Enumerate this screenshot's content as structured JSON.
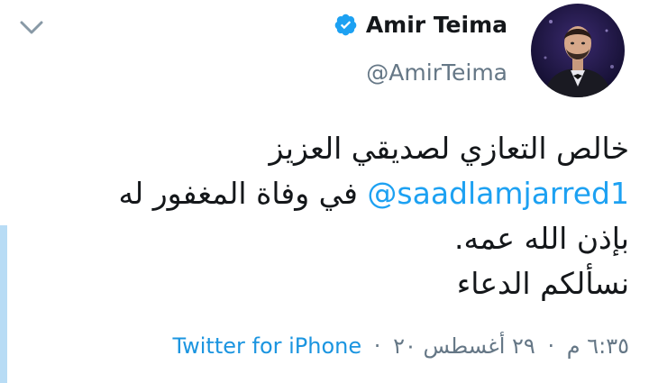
{
  "tweet": {
    "author": {
      "display_name": "Amir Teima",
      "handle": "@AmirTeima",
      "verified": true,
      "avatar_icon": "profile-photo"
    },
    "menu_icon": "chevron-down-icon",
    "text": {
      "line1": "خالص التعازي لصديقي العزيز",
      "line2_mention": "@saadlamjarred1",
      "line2_text": " في وفاة المغفور له",
      "line3": "بإذن الله عمه.",
      "line4": "نسألكم الدعاء"
    },
    "meta": {
      "time": "٦:٣٥ م",
      "separator": "·",
      "date": "٢٩ أغسطس ٢٠",
      "source": "Twitter for iPhone"
    }
  },
  "colors": {
    "link": "#1da1f2",
    "secondary_text": "#657786",
    "verified_badge": "#1da1f2",
    "left_accent": "#b8dcf5"
  }
}
